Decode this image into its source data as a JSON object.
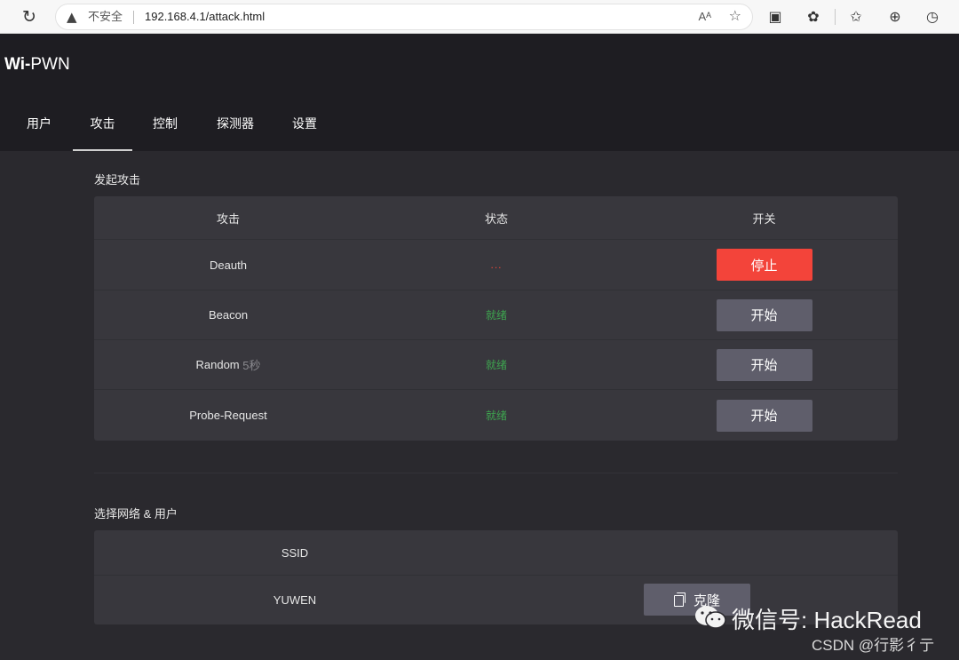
{
  "browser": {
    "security_label": "不安全",
    "url": "192.168.4.1/attack.html",
    "read_aloud": "Aᴬ"
  },
  "app": {
    "brand_bold": "Wi-",
    "brand_rest": "PWN",
    "nav": [
      "用户",
      "攻击",
      "控制",
      "探测器",
      "设置"
    ],
    "active_nav": "攻击"
  },
  "attack_section": {
    "title": "发起攻击",
    "headers": [
      "攻击",
      "状态",
      "开关"
    ],
    "rows": [
      {
        "name": "Deauth",
        "sub": "",
        "status": "...",
        "button": "停止"
      },
      {
        "name": "Beacon",
        "sub": "",
        "status": "就绪",
        "button": "开始"
      },
      {
        "name": "Random",
        "sub": "5秒",
        "status": "就绪",
        "button": "开始"
      },
      {
        "name": "Probe-Request",
        "sub": "",
        "status": "就绪",
        "button": "开始"
      }
    ]
  },
  "network_section": {
    "title": "选择网络 & 用户",
    "ssid_header": "SSID",
    "ssid_value": "YUWEN",
    "clone_button": "克隆"
  },
  "watermark": {
    "main": "微信号: HackRead",
    "sub": "CSDN @行影彳亍"
  },
  "colors": {
    "stop_button": "#f3443a",
    "start_button": "#5f5e6b",
    "status_ready": "#3ea54f",
    "status_busy": "#e8463a",
    "header_bg": "#1e1d22",
    "page_bg": "#2a292e",
    "card_bg": "#38373d"
  }
}
